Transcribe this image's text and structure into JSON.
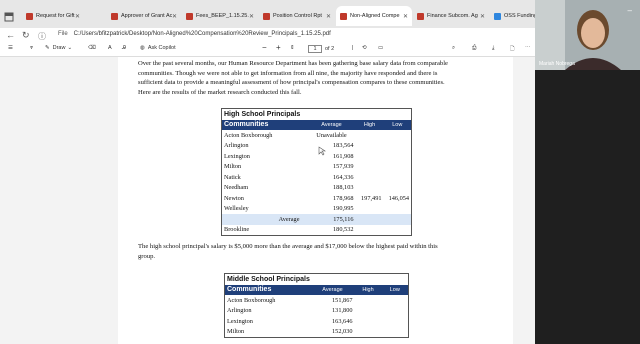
{
  "browser": {
    "tabs": [
      {
        "title": "Request for Gift Acc",
        "icon_color": "#c0392b",
        "active": false
      },
      {
        "title": "Approver of Grant Ac",
        "icon_color": "#c0392b",
        "active": false
      },
      {
        "title": "Fees_BEEP_1.15.25.p",
        "icon_color": "#c0392b",
        "active": false
      },
      {
        "title": "Position Control Rpt",
        "icon_color": "#c0392b",
        "active": false
      },
      {
        "title": "Non-Aligned Compe",
        "icon_color": "#c0392b",
        "active": true
      },
      {
        "title": "Finance Subcom. Ag",
        "icon_color": "#c0392b",
        "active": false
      },
      {
        "title": "OSS Funding Source",
        "icon_color": "#2e86de",
        "active": false
      }
    ],
    "address": {
      "scheme_label": "File",
      "url": "C:/Users/bfitzpatrick/Desktop/Non-Aligned%20Compensation%20Review_Principals_1.15.25.pdf"
    },
    "pdf_toolbar": {
      "draw_label": "Draw",
      "ask_copilot_label": "Ask Copilot",
      "page_current": "1",
      "page_total_label": "of 2"
    }
  },
  "document": {
    "intro": [
      "Over the past several months, our Human Resource Department has been gathering base salary data from comparable",
      "communities. Though we were not able to get information from all nine, the majority have responded and there is",
      "sufficient data to provide a meaningful assessment of how principal's compensation compares to these communities.",
      "Here are the results of the market research conducted this fall."
    ],
    "hs_table": {
      "caption": "High School Principals",
      "headers": {
        "name": "Communities",
        "avg": "Average",
        "high": "High",
        "low": "Low"
      },
      "rows": [
        {
          "name": "Acton Boxborough",
          "avg": "Unavailable",
          "high": "",
          "low": ""
        },
        {
          "name": "Arlington",
          "avg": "183,564",
          "high": "",
          "low": ""
        },
        {
          "name": "Lexington",
          "avg": "161,908",
          "high": "",
          "low": ""
        },
        {
          "name": "Milton",
          "avg": "157,939",
          "high": "",
          "low": ""
        },
        {
          "name": "Natick",
          "avg": "164,336",
          "high": "",
          "low": ""
        },
        {
          "name": "Needham",
          "avg": "188,103",
          "high": "",
          "low": ""
        },
        {
          "name": "Newton",
          "avg": "178,968",
          "high": "197,491",
          "low": "146,054"
        },
        {
          "name": "Wellesley",
          "avg": "190,995",
          "high": "",
          "low": ""
        }
      ],
      "average_row": {
        "label": "Average",
        "avg": "175,116"
      },
      "district_row": {
        "name": "Brookline",
        "avg": "180,532"
      }
    },
    "hs_summary": [
      "The high school principal's salary is $5,000 more than the average and $17,000 below the highest paid within this",
      "group."
    ],
    "ms_table": {
      "caption": "Middle School Principals",
      "headers": {
        "name": "Communities",
        "avg": "Average",
        "high": "High",
        "low": "Low"
      },
      "rows": [
        {
          "name": "Acton Boxborough",
          "avg": "151,867"
        },
        {
          "name": "Arlington",
          "avg": "131,800"
        },
        {
          "name": "Lexington",
          "avg": "163,646"
        },
        {
          "name": "Milton",
          "avg": "152,030"
        }
      ]
    }
  },
  "webcam": {
    "participant_name": "Mariah Nobrega"
  }
}
